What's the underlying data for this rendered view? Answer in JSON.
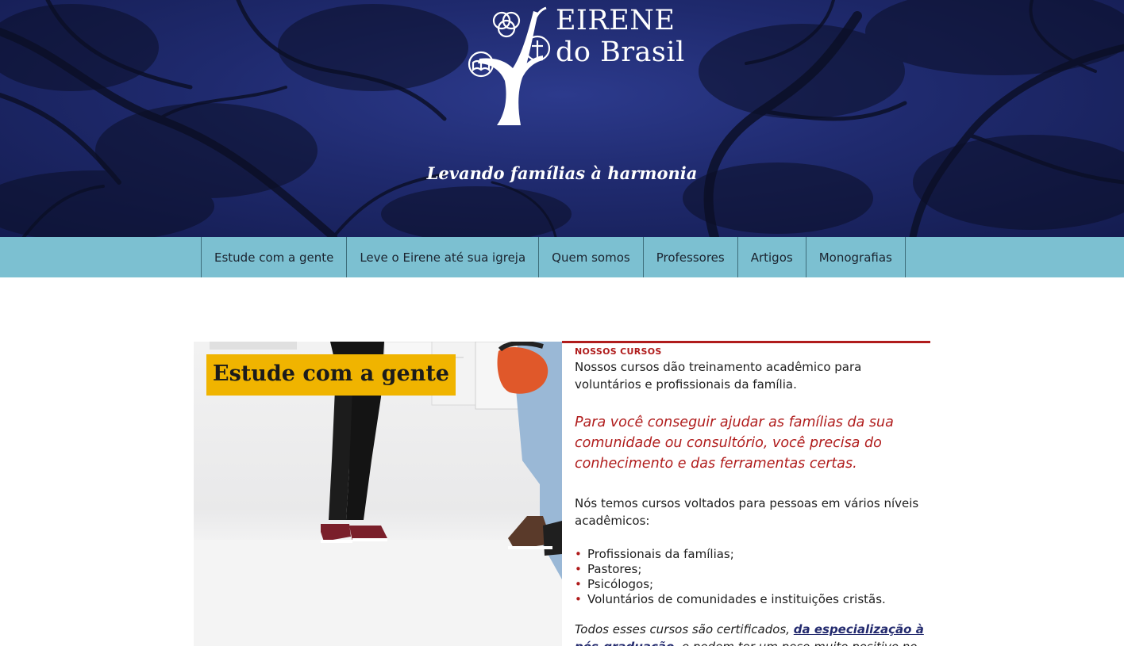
{
  "brand": {
    "line1": "EIRENE",
    "line2": "do Brasil",
    "tagline": "Levando famílias à harmonia"
  },
  "nav": {
    "items": [
      {
        "label": "Estude com a gente"
      },
      {
        "label": "Leve o Eirene até sua igreja"
      },
      {
        "label": "Quem somos"
      },
      {
        "label": "Professores"
      },
      {
        "label": "Artigos"
      },
      {
        "label": "Monografias"
      }
    ]
  },
  "section": {
    "badge": "Estude com a gente",
    "kicker": "NOSSOS CURSOS",
    "intro": "Nossos cursos dão treinamento acadêmico para voluntários e profissionais da família.",
    "lead": "Para você conseguir ajudar as famílias da sua comunidade ou consultório, você precisa do conhecimento e das ferramentas certas.",
    "levels": "Nós temos cursos voltados para pessoas em vários níveis acadêmicos:",
    "audience": [
      "Profissionais da famílias;",
      "Pastores;",
      "Psicólogos;",
      "Voluntários de comunidades e instituições cristãs."
    ],
    "cert_start": "Todos esses cursos são certificados, ",
    "cert_highlight": "da especialização à pós-graduação",
    "cert_end": ", e podem ter um peso muito positivo no"
  },
  "colors": {
    "hero_bg": "#1f2a6e",
    "nav_bg": "#7cc0d1",
    "accent_red": "#b01c1c",
    "badge_yellow": "#f0b400",
    "link_navy": "#232a6e"
  },
  "icons": [
    "tree-logo-icon",
    "book-icon",
    "cross-icon",
    "circles-icon",
    "bullet-icon"
  ]
}
